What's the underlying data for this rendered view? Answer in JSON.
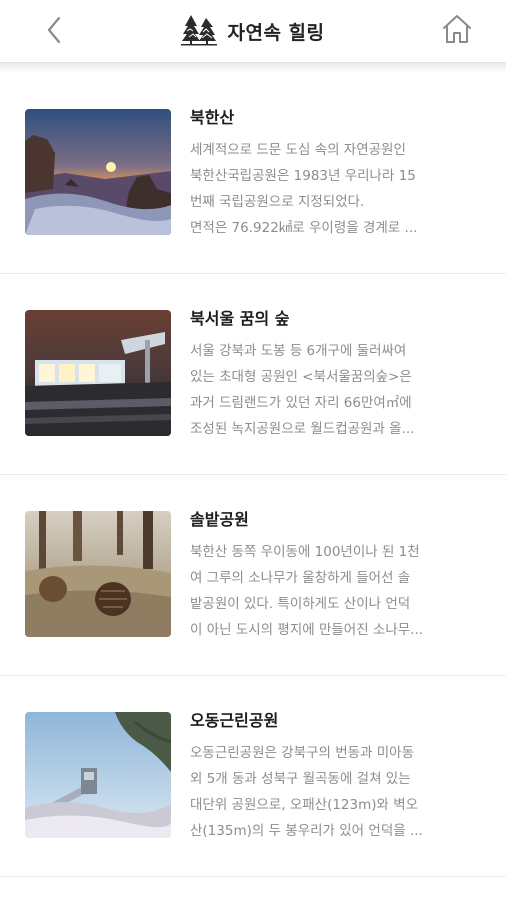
{
  "header": {
    "title": "자연속 힐링",
    "logo_icon": "pine-trees-logo-icon",
    "back_icon": "chevron-left-icon",
    "home_icon": "home-icon"
  },
  "items": [
    {
      "title": "북한산",
      "image": "mountain-sunset-image",
      "lines": [
        "세계적으로 드문 도심 속의 자연공원인",
        "북한산국립공원은 1983년 우리나라 15",
        "번째 국립공원으로 지정되었다.",
        "면적은 76.922㎢로 우이령을 경계로 ..."
      ]
    },
    {
      "title": "북서울 꿈의 숲",
      "image": "observatory-night-image",
      "lines": [
        "서울 강북과 도봉 등 6개구에 둘러싸여",
        "있는 초대형 공원인 <북서울꿈의숲>은",
        "과거 드림랜드가 있던 자리 66만여㎡에",
        "조성된 녹지공원으로 월드컵공원과 올..."
      ]
    },
    {
      "title": "솔밭공원",
      "image": "pine-cones-image",
      "lines": [
        "북한산 동쪽 우이동에 100년이나 된 1천",
        "여 그루의 소나무가 울창하게 들어선 솔",
        "밭공원이 있다. 특이하게도 산이나 언덕",
        "이 아닌 도시의 평지에 만들어진 소나무..."
      ]
    },
    {
      "title": "오동근린공원",
      "image": "park-tower-image",
      "lines": [
        "오동근린공원은 강북구의 번동과 미아동",
        "외 5개 동과 성북구 월곡동에 걸쳐 있는",
        "대단위 공원으로, 오패산(123m)와 벽오",
        "산(135m)의 두 봉우리가 있어 언덕을 ..."
      ]
    }
  ]
}
